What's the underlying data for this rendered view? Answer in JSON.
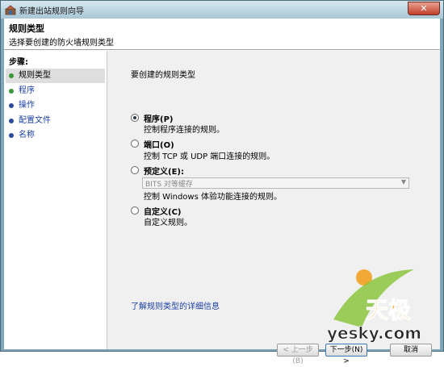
{
  "window": {
    "title": "新建出站规则向导",
    "close_glyph": "✕"
  },
  "header": {
    "title": "规则类型",
    "subtitle": "选择要创建的防火墙规则类型"
  },
  "steps": {
    "heading": "步骤:",
    "items": [
      {
        "label": "规则类型"
      },
      {
        "label": "程序"
      },
      {
        "label": "操作"
      },
      {
        "label": "配置文件"
      },
      {
        "label": "名称"
      }
    ]
  },
  "content": {
    "prompt": "要创建的规则类型",
    "options": [
      {
        "title": "程序(P)",
        "description": "控制程序连接的规则。"
      },
      {
        "title": "端口(O)",
        "description": "控制 TCP 或 UDP 端口连接的规则。"
      },
      {
        "title": "预定义(E):",
        "description": "控制 Windows 体验功能连接的规则。"
      },
      {
        "title": "自定义(C)",
        "description": "自定义规则。"
      }
    ],
    "predefined_select": {
      "value": "BITS 对等缓存"
    },
    "more_info_link": "了解规则类型的详细信息"
  },
  "buttons": {
    "back": "< 上一步(B)",
    "next": "下一步(N) >",
    "cancel": "取消"
  },
  "watermark": {
    "brand_cn": "天极",
    "domain": "yesky.com"
  },
  "colors": {
    "step_done": "#3a9a3a",
    "step_pending": "#2a4aa0",
    "link": "#1a3fa6"
  }
}
